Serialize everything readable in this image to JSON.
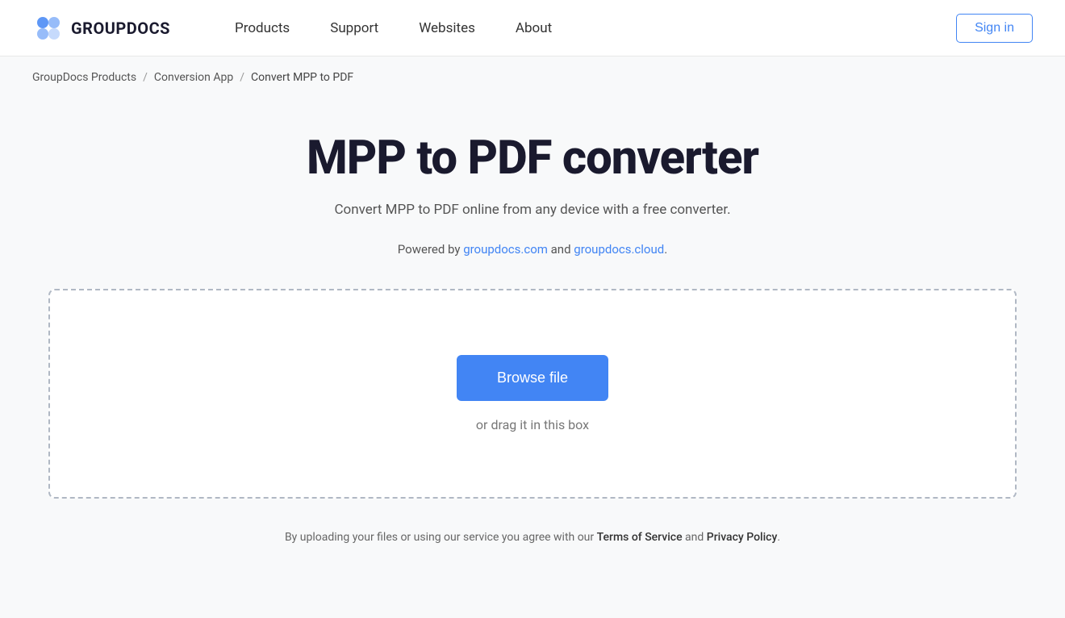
{
  "header": {
    "logo_text": "GROUPDOCS",
    "nav": {
      "products": "Products",
      "support": "Support",
      "websites": "Websites",
      "about": "About"
    },
    "sign_in": "Sign in"
  },
  "breadcrumb": {
    "home": "GroupDocs Products",
    "conversion_app": "Conversion App",
    "current": "Convert MPP to PDF"
  },
  "main": {
    "title": "MPP to PDF converter",
    "subtitle": "Convert MPP to PDF online from any device with a free converter.",
    "powered_by_prefix": "Powered by ",
    "powered_by_link1": "groupdocs.com",
    "powered_by_and": " and ",
    "powered_by_link2": "groupdocs.cloud",
    "powered_by_suffix": ".",
    "browse_button": "Browse file",
    "drag_text": "or drag it in this box"
  },
  "footer_note": {
    "prefix": "By uploading your files or using our service you agree with our ",
    "tos": "Terms of Service",
    "middle": " and ",
    "privacy": "Privacy Policy",
    "suffix": "."
  },
  "colors": {
    "accent": "#4285f4",
    "text_dark": "#1a1a2e",
    "text_mid": "#555",
    "text_light": "#777"
  }
}
